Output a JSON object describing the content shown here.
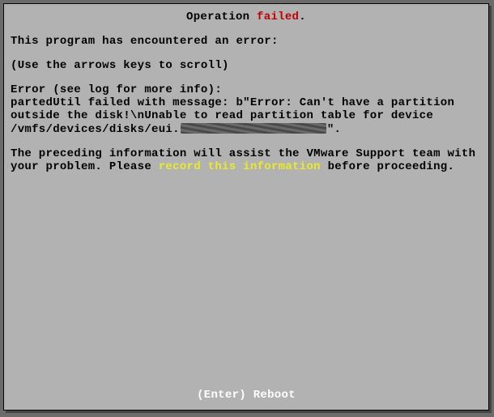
{
  "title": {
    "prefix": "Operation ",
    "status": "failed",
    "suffix": "."
  },
  "intro": "This program has encountered an error:",
  "hint": "(Use the arrows keys to scroll)",
  "error_header": "Error (see log for more info):",
  "error_line1": "partedUtil failed with message: b\"Error: Can't have a partition",
  "error_line2": "outside the disk!\\nUnable to read partition table for device",
  "error_path_prefix": "/vmfs/devices/disks/eui.",
  "error_path_suffix": "\".",
  "support_line1": "The preceding information will assist the VMware Support team with",
  "support_line2a": "your problem. Please ",
  "support_highlight": "record this information",
  "support_line2b": " before proceeding.",
  "footer": "(Enter) Reboot"
}
